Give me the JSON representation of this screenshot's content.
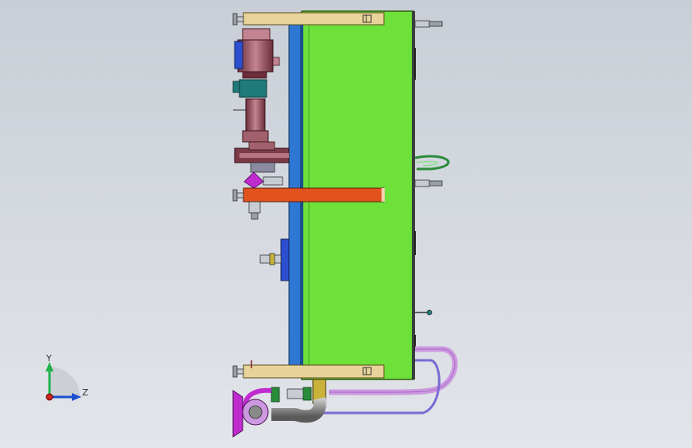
{
  "viewport": {
    "background_top": "#c9ced6",
    "background_bottom": "#e2e5ea"
  },
  "model": {
    "components": [
      "top-bracket",
      "bottom-bracket",
      "middle-bracket",
      "tank-body",
      "blue-rail",
      "motor",
      "pump",
      "pipe-assembly",
      "side-valves",
      "side-fitting",
      "inlet-flange"
    ],
    "colors": {
      "tank": "#6ee03a",
      "tank_edge": "#2f5a12",
      "rail": "#2e78d4",
      "bracket_tan": "#e8d49a",
      "bracket_orange": "#e2521e",
      "motor": "#b57480",
      "motor_dark": "#6a2e3a",
      "teal": "#1f7a7a",
      "pipe_pink": "#cc99e0",
      "pipe_purple": "#b04fcc",
      "flange_magenta": "#c02bd0",
      "elbow_gray": "#8a8a8a",
      "fitting_green": "#2a8c3a"
    }
  },
  "triad": {
    "y_label": "Y",
    "z_label": "Z",
    "y_color": "#22b14c",
    "z_color": "#1a4fcf",
    "origin_color": "#cc2222"
  }
}
